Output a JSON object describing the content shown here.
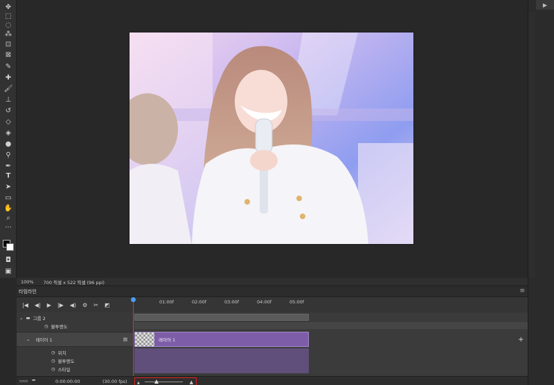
{
  "status_bar": {
    "zoom": "100%",
    "doc_info": "700 픽셀 x 522 픽셀 (96 ppi)"
  },
  "timeline": {
    "tab_label": "타임라인",
    "menu_icon": "menu-lines-icon",
    "ruler_ticks": [
      "01:00f",
      "02:00f",
      "03:00f",
      "04:00f",
      "05:00f"
    ],
    "rows": {
      "group_name": "그룹 2",
      "group_property": "불투명도",
      "layer_name": "레이어 1",
      "layer_props": [
        "위치",
        "불투명도",
        "스타일"
      ]
    },
    "clip_label": "레이어 1",
    "current_time": "0:00:00:00",
    "fps": "(30.00 fps)"
  },
  "colors": {
    "clip": "#7d5ca8",
    "playhead": "#d83a3a",
    "zoom_highlight": "#e02020"
  }
}
